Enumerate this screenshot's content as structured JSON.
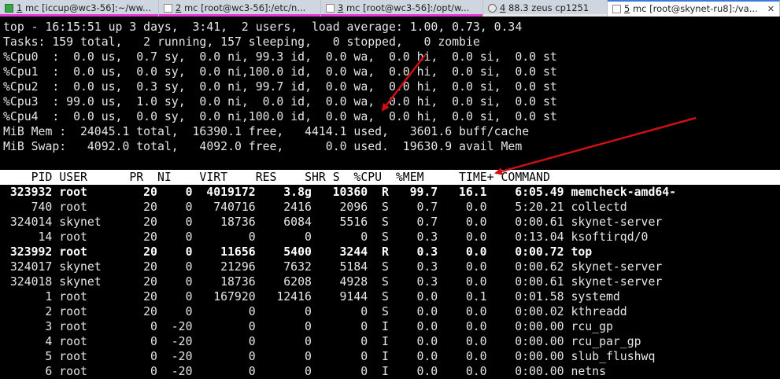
{
  "tabs": [
    {
      "number": "1",
      "title": " mc [iccup@wc3-56]:~/ww..."
    },
    {
      "number": "2",
      "title": " mc [root@wc3-56]:/etc/n..."
    },
    {
      "number": "3",
      "title": " mc [root@wc3-56]:/opt/w..."
    },
    {
      "number": "4",
      "title": " 88.3 zeus cp1251"
    },
    {
      "number": "5",
      "title": " mc [root@skynet-ru8]:/va..."
    }
  ],
  "summary": [
    "top - 16:15:51 up 3 days,  3:41,  2 users,  load average: 1.00, 0.73, 0.34",
    "Tasks: 159 total,   2 running, 157 sleeping,   0 stopped,   0 zombie",
    "%Cpu0  :  0.0 us,  0.7 sy,  0.0 ni, 99.3 id,  0.0 wa,  0.0 hi,  0.0 si,  0.0 st",
    "%Cpu1  :  0.0 us,  0.0 sy,  0.0 ni,100.0 id,  0.0 wa,  0.0 hi,  0.0 si,  0.0 st",
    "%Cpu2  :  0.0 us,  0.3 sy,  0.0 ni, 99.7 id,  0.0 wa,  0.0 hi,  0.0 si,  0.0 st",
    "%Cpu3  : 99.0 us,  1.0 sy,  0.0 ni,  0.0 id,  0.0 wa,  0.0 hi,  0.0 si,  0.0 st",
    "%Cpu4  :  0.0 us,  0.0 sy,  0.0 ni,100.0 id,  0.0 wa,  0.0 hi,  0.0 si,  0.0 st",
    "MiB Mem :  24045.1 total,  16390.1 free,   4414.1 used,   3601.6 buff/cache",
    "MiB Swap:   4092.0 total,   4092.0 free,      0.0 used.  19630.9 avail Mem"
  ],
  "process_header": "    PID USER      PR  NI    VIRT    RES    SHR S  %CPU  %MEM     TIME+ COMMAND",
  "processes": [
    {
      "pid": "323932",
      "user": "root",
      "pr": "20",
      "ni": "0",
      "virt": "4019172",
      "res": "3.8g",
      "shr": "10360",
      "s": "R",
      "cpu": "99.7",
      "mem": "16.1",
      "time": "6:05.49",
      "command": "memcheck-amd64-",
      "highlight": true
    },
    {
      "pid": "740",
      "user": "root",
      "pr": "20",
      "ni": "0",
      "virt": "740716",
      "res": "2416",
      "shr": "2096",
      "s": "S",
      "cpu": "0.7",
      "mem": "0.0",
      "time": "5:20.21",
      "command": "collectd",
      "highlight": false
    },
    {
      "pid": "324014",
      "user": "skynet",
      "pr": "20",
      "ni": "0",
      "virt": "18736",
      "res": "6084",
      "shr": "5516",
      "s": "S",
      "cpu": "0.7",
      "mem": "0.0",
      "time": "0:00.61",
      "command": "skynet-server",
      "highlight": false
    },
    {
      "pid": "14",
      "user": "root",
      "pr": "20",
      "ni": "0",
      "virt": "0",
      "res": "0",
      "shr": "0",
      "s": "S",
      "cpu": "0.3",
      "mem": "0.0",
      "time": "0:13.04",
      "command": "ksoftirqd/0",
      "highlight": false
    },
    {
      "pid": "323992",
      "user": "root",
      "pr": "20",
      "ni": "0",
      "virt": "11656",
      "res": "5400",
      "shr": "3244",
      "s": "R",
      "cpu": "0.3",
      "mem": "0.0",
      "time": "0:00.72",
      "command": "top",
      "highlight": true
    },
    {
      "pid": "324017",
      "user": "skynet",
      "pr": "20",
      "ni": "0",
      "virt": "21296",
      "res": "7632",
      "shr": "5184",
      "s": "S",
      "cpu": "0.3",
      "mem": "0.0",
      "time": "0:00.62",
      "command": "skynet-server",
      "highlight": false
    },
    {
      "pid": "324018",
      "user": "skynet",
      "pr": "20",
      "ni": "0",
      "virt": "18736",
      "res": "6208",
      "shr": "4928",
      "s": "S",
      "cpu": "0.3",
      "mem": "0.0",
      "time": "0:00.61",
      "command": "skynet-server",
      "highlight": false
    },
    {
      "pid": "1",
      "user": "root",
      "pr": "20",
      "ni": "0",
      "virt": "167920",
      "res": "12416",
      "shr": "9144",
      "s": "S",
      "cpu": "0.0",
      "mem": "0.1",
      "time": "0:01.58",
      "command": "systemd",
      "highlight": false
    },
    {
      "pid": "2",
      "user": "root",
      "pr": "20",
      "ni": "0",
      "virt": "0",
      "res": "0",
      "shr": "0",
      "s": "S",
      "cpu": "0.0",
      "mem": "0.0",
      "time": "0:00.02",
      "command": "kthreadd",
      "highlight": false
    },
    {
      "pid": "3",
      "user": "root",
      "pr": "0",
      "ni": "-20",
      "virt": "0",
      "res": "0",
      "shr": "0",
      "s": "I",
      "cpu": "0.0",
      "mem": "0.0",
      "time": "0:00.00",
      "command": "rcu_gp",
      "highlight": false
    },
    {
      "pid": "4",
      "user": "root",
      "pr": "0",
      "ni": "-20",
      "virt": "0",
      "res": "0",
      "shr": "0",
      "s": "I",
      "cpu": "0.0",
      "mem": "0.0",
      "time": "0:00.00",
      "command": "rcu_par_gp",
      "highlight": false
    },
    {
      "pid": "5",
      "user": "root",
      "pr": "0",
      "ni": "-20",
      "virt": "0",
      "res": "0",
      "shr": "0",
      "s": "I",
      "cpu": "0.0",
      "mem": "0.0",
      "time": "0:00.00",
      "command": "slub_flushwq",
      "highlight": false
    },
    {
      "pid": "6",
      "user": "root",
      "pr": "0",
      "ni": "-20",
      "virt": "0",
      "res": "0",
      "shr": "0",
      "s": "I",
      "cpu": "0.0",
      "mem": "0.0",
      "time": "0:00.00",
      "command": "netns",
      "highlight": false
    }
  ],
  "icons": {
    "tab_mark": "terminal-icon",
    "tab_close": "close-icon"
  },
  "colors": {
    "terminal_bg": "#000000",
    "terminal_fg": "#e6e6e6",
    "header_bg": "#ffffff",
    "annotation_arrow": "#cc1111",
    "active_tab_accent": "#e63ad6"
  }
}
